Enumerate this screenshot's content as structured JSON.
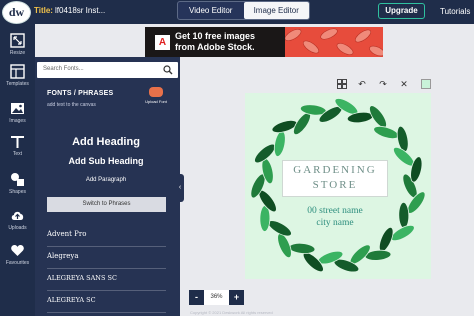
{
  "app": {
    "logo_text": "dw",
    "title_label": "Title:",
    "title_value": "lf0418sr Inst..."
  },
  "modes": [
    {
      "label": "Video Editor",
      "active": false
    },
    {
      "label": "Image Editor",
      "active": true
    }
  ],
  "header": {
    "upgrade_label": "Upgrade",
    "tutorials_label": "Tutorials"
  },
  "rail": [
    {
      "label": "Resize",
      "icon": "resize-icon"
    },
    {
      "label": "Templates",
      "icon": "templates-icon"
    },
    {
      "label": "Images",
      "icon": "images-icon"
    },
    {
      "label": "Text",
      "icon": "text-icon"
    },
    {
      "label": "Shapes",
      "icon": "shapes-icon"
    },
    {
      "label": "Uploads",
      "icon": "uploads-icon"
    },
    {
      "label": "Favourites",
      "icon": "favourites-icon"
    }
  ],
  "panel": {
    "search_placeholder": "Search Fonts...",
    "section_title": "FONTS / PHRASES",
    "section_sub": "add text to the canvas",
    "upload_label": "Upload Font",
    "add_heading": "Add Heading",
    "add_subheading": "Add Sub Heading",
    "add_paragraph": "Add Paragraph",
    "switch_label": "Switch to Phrases",
    "fonts": [
      "Advent Pro",
      "Alegreya",
      "ALEGREYA SANS SC",
      "ALEGREYA SC"
    ]
  },
  "ad": {
    "brand": "A",
    "line1": "Get 10 free images",
    "line2": "from Adobe Stock."
  },
  "design": {
    "title_line1": "GARDENING",
    "title_line2": "STORE",
    "address_line1": "00 street name",
    "address_line2": "city name",
    "background_color": "#ddf6e3"
  },
  "zoom": {
    "minus": "-",
    "value": "36%",
    "plus": "+"
  },
  "footer": "Copyright © 2021 Deskwork All rights reserved"
}
